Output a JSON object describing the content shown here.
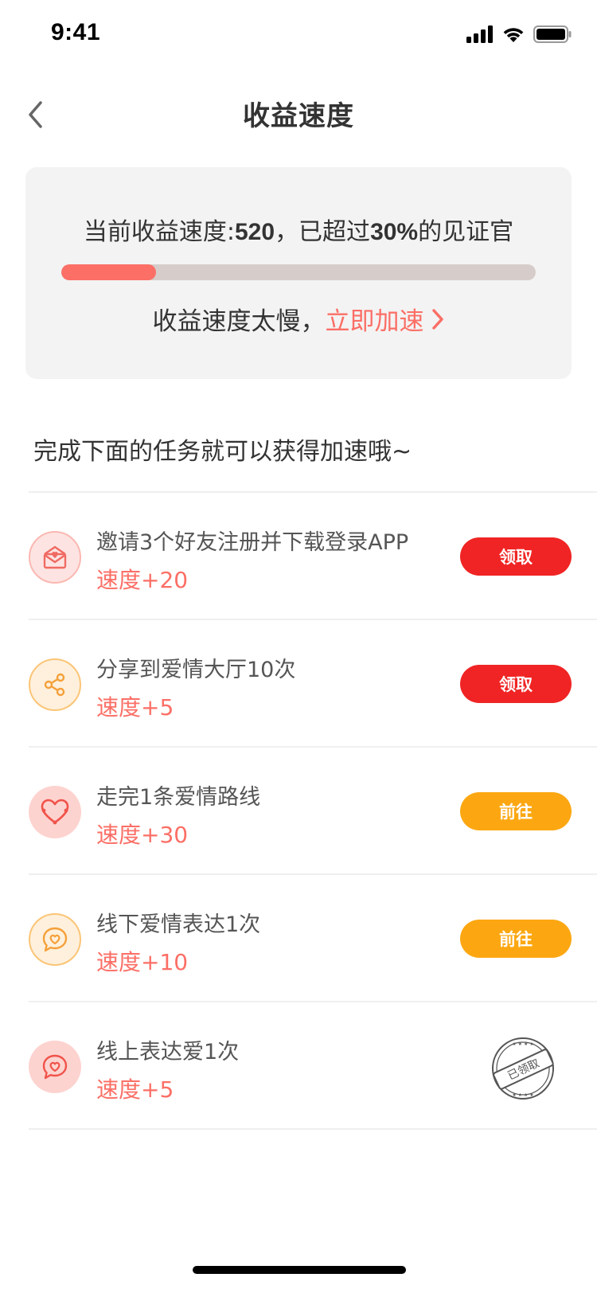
{
  "status_bar": {
    "time": "9:41"
  },
  "nav": {
    "title": "收益速度"
  },
  "speed_card": {
    "prefix": "当前收益速度:",
    "speed_value": "520",
    "middle": "，已超过",
    "percent": "30%",
    "suffix": "的见证官",
    "progress_fraction": 0.2,
    "slow_text": "收益速度太慢，",
    "accelerate_label": "立即加速"
  },
  "section": {
    "title": "完成下面的任务就可以获得加速哦~"
  },
  "tasks": [
    {
      "title": "邀请3个好友注册并下载登录APP",
      "speed": "速度+20",
      "icon": "envelope-heart-icon",
      "action": "领取",
      "action_type": "claim"
    },
    {
      "title": "分享到爱情大厅10次",
      "speed": "速度+5",
      "icon": "share-icon",
      "action": "领取",
      "action_type": "claim"
    },
    {
      "title": "走完1条爱情路线",
      "speed": "速度+30",
      "icon": "heart-route-icon",
      "action": "前往",
      "action_type": "go"
    },
    {
      "title": "线下爱情表达1次",
      "speed": "速度+10",
      "icon": "chat-heart-icon",
      "action": "前往",
      "action_type": "go"
    },
    {
      "title": "线上表达爱1次",
      "speed": "速度+5",
      "icon": "chat-heart-icon",
      "action": "已领取",
      "action_type": "claimed-stamp"
    }
  ],
  "colors": {
    "accent": "#fb6f66",
    "claim_button": "#f02424",
    "go_button": "#fca712",
    "progress_track": "#d6cdca",
    "card_bg": "#f3f3f3"
  }
}
